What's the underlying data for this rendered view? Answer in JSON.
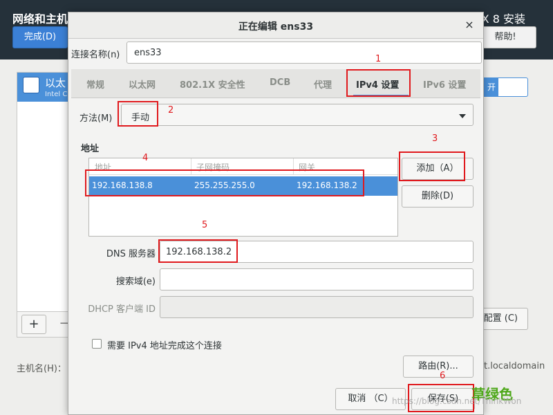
{
  "background": {
    "title": "网络和主机",
    "title_right": "X 8 安装",
    "done_button": "完成(D)",
    "help_button": "帮助!",
    "device_name": "以太",
    "device_sub": "Intel C",
    "toggle_label": "开",
    "add_symbol": "+",
    "remove_symbol": "−",
    "configure_button": "配置 (C)",
    "hostname_label": "主机名(H)：",
    "domain_text": "t.localdomain"
  },
  "dialog": {
    "title": "正在编辑 ens33",
    "close_symbol": "×",
    "connection_name_label": "连接名称(n)",
    "connection_name_value": "ens33",
    "tabs": [
      {
        "label": "常规"
      },
      {
        "label": "以太网"
      },
      {
        "label": "802.1X 安全性"
      },
      {
        "label": "DCB"
      },
      {
        "label": "代理"
      },
      {
        "label": "IPv4 设置"
      },
      {
        "label": "IPv6 设置"
      }
    ],
    "method_label": "方法(M)",
    "method_value": "手动",
    "address_heading": "地址",
    "address_columns": [
      "地址",
      "子网掩码",
      "网关"
    ],
    "address_rows": [
      [
        "192.168.138.8",
        "255.255.255.0",
        "192.168.138.2"
      ]
    ],
    "add_button": "添加（A）",
    "delete_button": "删除(D)",
    "dns_label": "DNS 服务器",
    "dns_value": "192.168.138.2",
    "search_label": "搜索域(e)",
    "search_value": "",
    "dhcp_label": "DHCP 客户端 ID",
    "dhcp_value": "",
    "require_ipv4_label": "需要 IPv4 地址完成这个连接",
    "routes_button": "路由(R)...",
    "cancel_button": "取消 （C）",
    "save_button": "保存(S)"
  },
  "annotations": [
    "1",
    "2",
    "3",
    "4",
    "5",
    "6"
  ],
  "watermarks": {
    "green": "草绿色",
    "csdn": "https://blog.csdn.net/ThinkWon"
  },
  "colors": {
    "selection": "#4a90d9",
    "annotation": "#e0191d",
    "header_bg": "#25313a"
  }
}
